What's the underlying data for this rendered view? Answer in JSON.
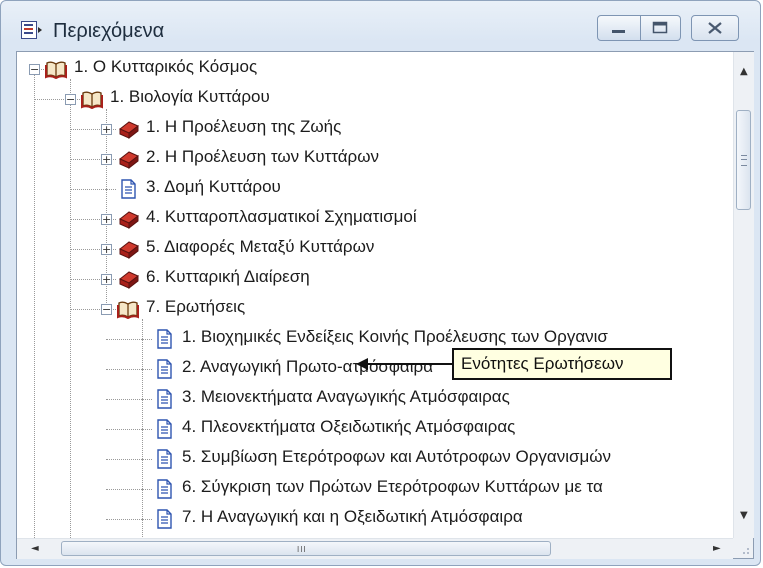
{
  "window": {
    "title": "Περιεχόμενα",
    "icon": "contents-icon"
  },
  "controls": {
    "minimize": "minimize-icon",
    "maximize": "maximize-icon",
    "close": "close-icon"
  },
  "tree": {
    "nodes": [
      {
        "level": 0,
        "expander": "minus",
        "icon": "open-book-icon",
        "label": "1.  Ο Κυτταρικός Κόσμος"
      },
      {
        "level": 1,
        "expander": "minus",
        "icon": "open-book-icon",
        "label": "1.  Βιολογία Κυττάρου"
      },
      {
        "level": 2,
        "expander": "plus",
        "icon": "closed-book-icon",
        "label": "1.  Η Προέλευση της Ζωής"
      },
      {
        "level": 2,
        "expander": "plus",
        "icon": "closed-book-icon",
        "label": "2.  Η Προέλευση των Κυττάρων"
      },
      {
        "level": 2,
        "expander": "none",
        "icon": "page-icon",
        "label": "3.  Δομή Κυττάρου"
      },
      {
        "level": 2,
        "expander": "plus",
        "icon": "closed-book-icon",
        "label": "4.  Κυτταροπλασματικοί Σχηματισμοί"
      },
      {
        "level": 2,
        "expander": "plus",
        "icon": "closed-book-icon",
        "label": "5.  Διαφορές Μεταξύ Κυττάρων"
      },
      {
        "level": 2,
        "expander": "plus",
        "icon": "closed-book-icon",
        "label": "6.  Κυτταρική Διαίρεση"
      },
      {
        "level": 2,
        "expander": "minus",
        "icon": "open-book-icon",
        "label": "7.  Ερωτήσεις"
      },
      {
        "level": 3,
        "expander": "none",
        "icon": "page-icon",
        "label": "1.  Βιοχημικές Ενδείξεις Κοινής Προέλευσης των Οργανισ"
      },
      {
        "level": 3,
        "expander": "none",
        "icon": "page-icon",
        "label": "2.  Αναγωγική Πρωτο-ατμόσφαιρα"
      },
      {
        "level": 3,
        "expander": "none",
        "icon": "page-icon",
        "label": "3.  Μειονεκτήματα Αναγωγικής Ατμόσφαιρας"
      },
      {
        "level": 3,
        "expander": "none",
        "icon": "page-icon",
        "label": "4.  Πλεονεκτήματα Οξειδωτικής Ατμόσφαιρας"
      },
      {
        "level": 3,
        "expander": "none",
        "icon": "page-icon",
        "label": "5.  Συμβίωση Ετερότροφων και Αυτότροφων Οργανισμών"
      },
      {
        "level": 3,
        "expander": "none",
        "icon": "page-icon",
        "label": "6.  Σύγκριση των Πρώτων Ετερότροφων Κυττάρων με τα"
      },
      {
        "level": 3,
        "expander": "none",
        "icon": "page-icon",
        "label": "7.  Η Αναγωγική και η Οξειδωτική Ατμόσφαιρα"
      }
    ]
  },
  "callout": {
    "text": "Ενότητες Ερωτήσεων"
  },
  "scrollbars": {
    "h_grip": "III"
  },
  "colors": {
    "book_red": "#a8201a",
    "page_blue": "#2f55b0",
    "callout_bg": "#ffffe1"
  }
}
